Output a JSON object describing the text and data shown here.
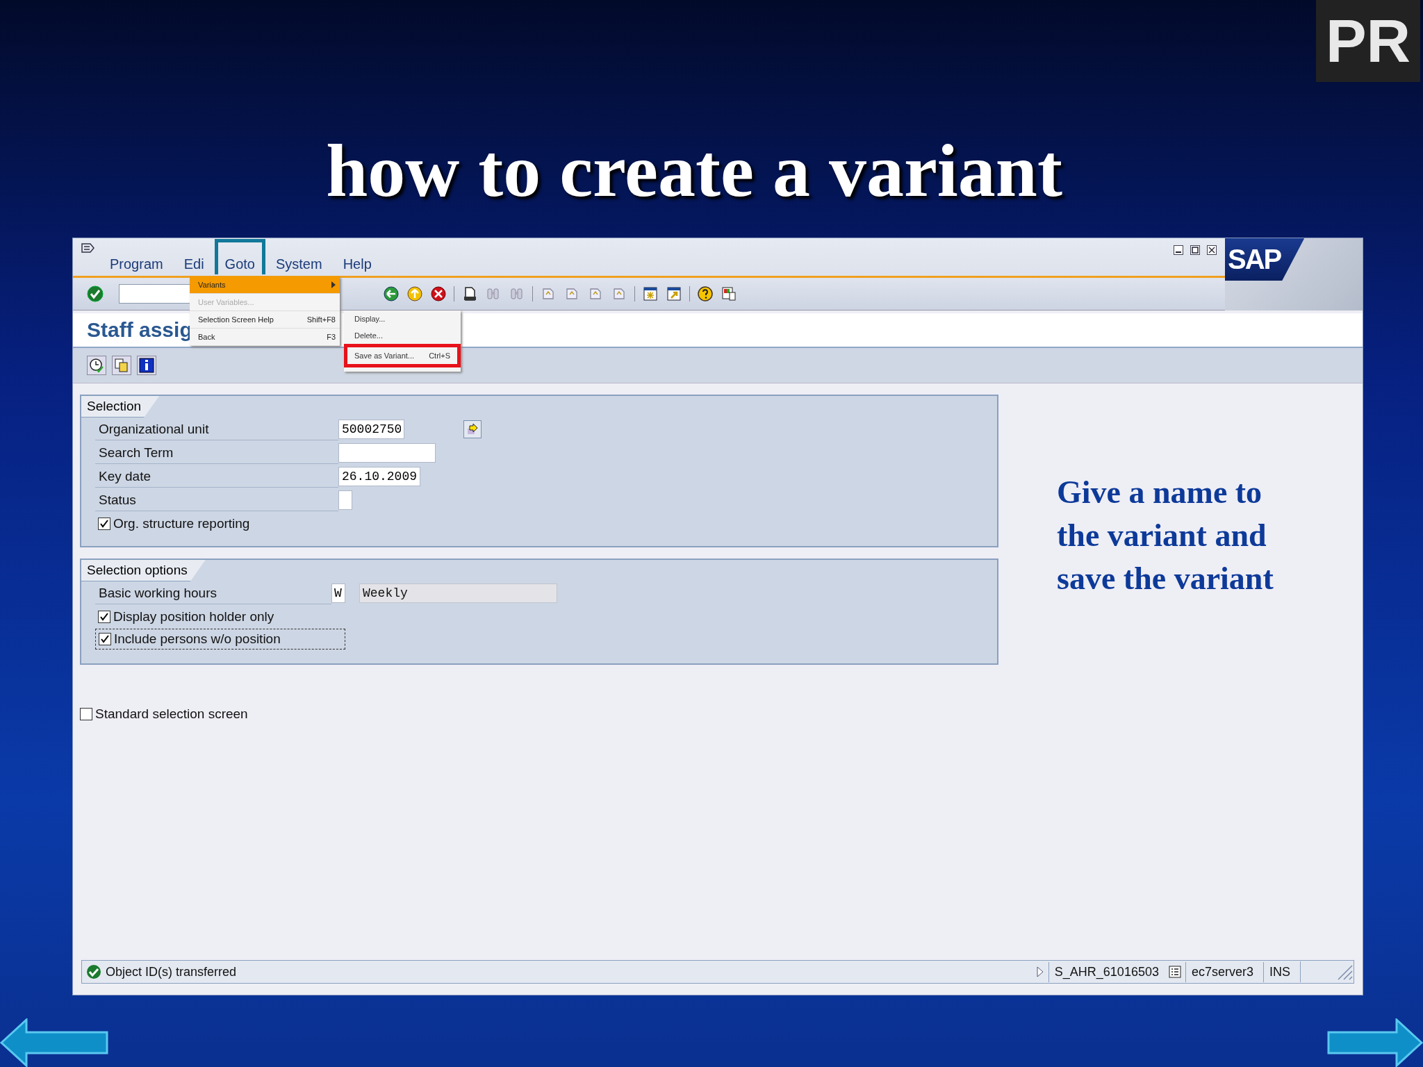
{
  "slide": {
    "title": "how to create a variant",
    "logo": "PR",
    "note": "Give a name to the variant and save the variant"
  },
  "window": {
    "menus": [
      {
        "label": "Program",
        "selected": false
      },
      {
        "label": "Edi",
        "selected": false
      },
      {
        "label": "Goto",
        "selected": true
      },
      {
        "label": "System",
        "selected": false
      },
      {
        "label": "Help",
        "selected": false
      }
    ],
    "brand": "SAP",
    "title": "Staff assig"
  },
  "goto_menu": [
    {
      "label": "Variants",
      "selected": true,
      "disabled": false,
      "submenu": true
    },
    {
      "label": "User Variables...",
      "selected": false,
      "disabled": true,
      "submenu": false
    },
    {
      "label": "Selection Screen Help",
      "shortcut": "Shift+F8",
      "selected": false,
      "disabled": false,
      "submenu": false
    },
    {
      "label": "Back",
      "shortcut": "F3",
      "selected": false,
      "disabled": false,
      "submenu": false
    }
  ],
  "variants_submenu": [
    {
      "label": "Display...",
      "marked": false
    },
    {
      "label": "Delete...",
      "marked": false
    },
    {
      "label": "Save as Variant...",
      "shortcut": "Ctrl+S",
      "marked": true
    }
  ],
  "selection": {
    "title": "Selection",
    "fields": [
      {
        "label": "Organizational unit",
        "value": "50002750",
        "kind": "id"
      },
      {
        "label": "Search Term",
        "kind": "text"
      },
      {
        "label": "Key date",
        "value": "26.10.2009",
        "kind": "date"
      },
      {
        "label": "Status",
        "kind": "flag"
      }
    ],
    "checkbox": {
      "label": "Org. structure reporting",
      "checked": true
    }
  },
  "selection_options": {
    "title": "Selection options",
    "field": {
      "label": "Basic working hours",
      "value": "W",
      "description": "Weekly"
    },
    "checkboxes": [
      {
        "label": "Display position holder only",
        "checked": true,
        "focused": false
      },
      {
        "label": "Include persons w/o position",
        "checked": true,
        "focused": true
      }
    ]
  },
  "standard_selection": {
    "label": "Standard selection screen",
    "checked": false
  },
  "status_bar": {
    "message": "Object ID(s) transferred",
    "session": "S_AHR_61016503",
    "server": "ec7server3",
    "mode": "INS"
  }
}
